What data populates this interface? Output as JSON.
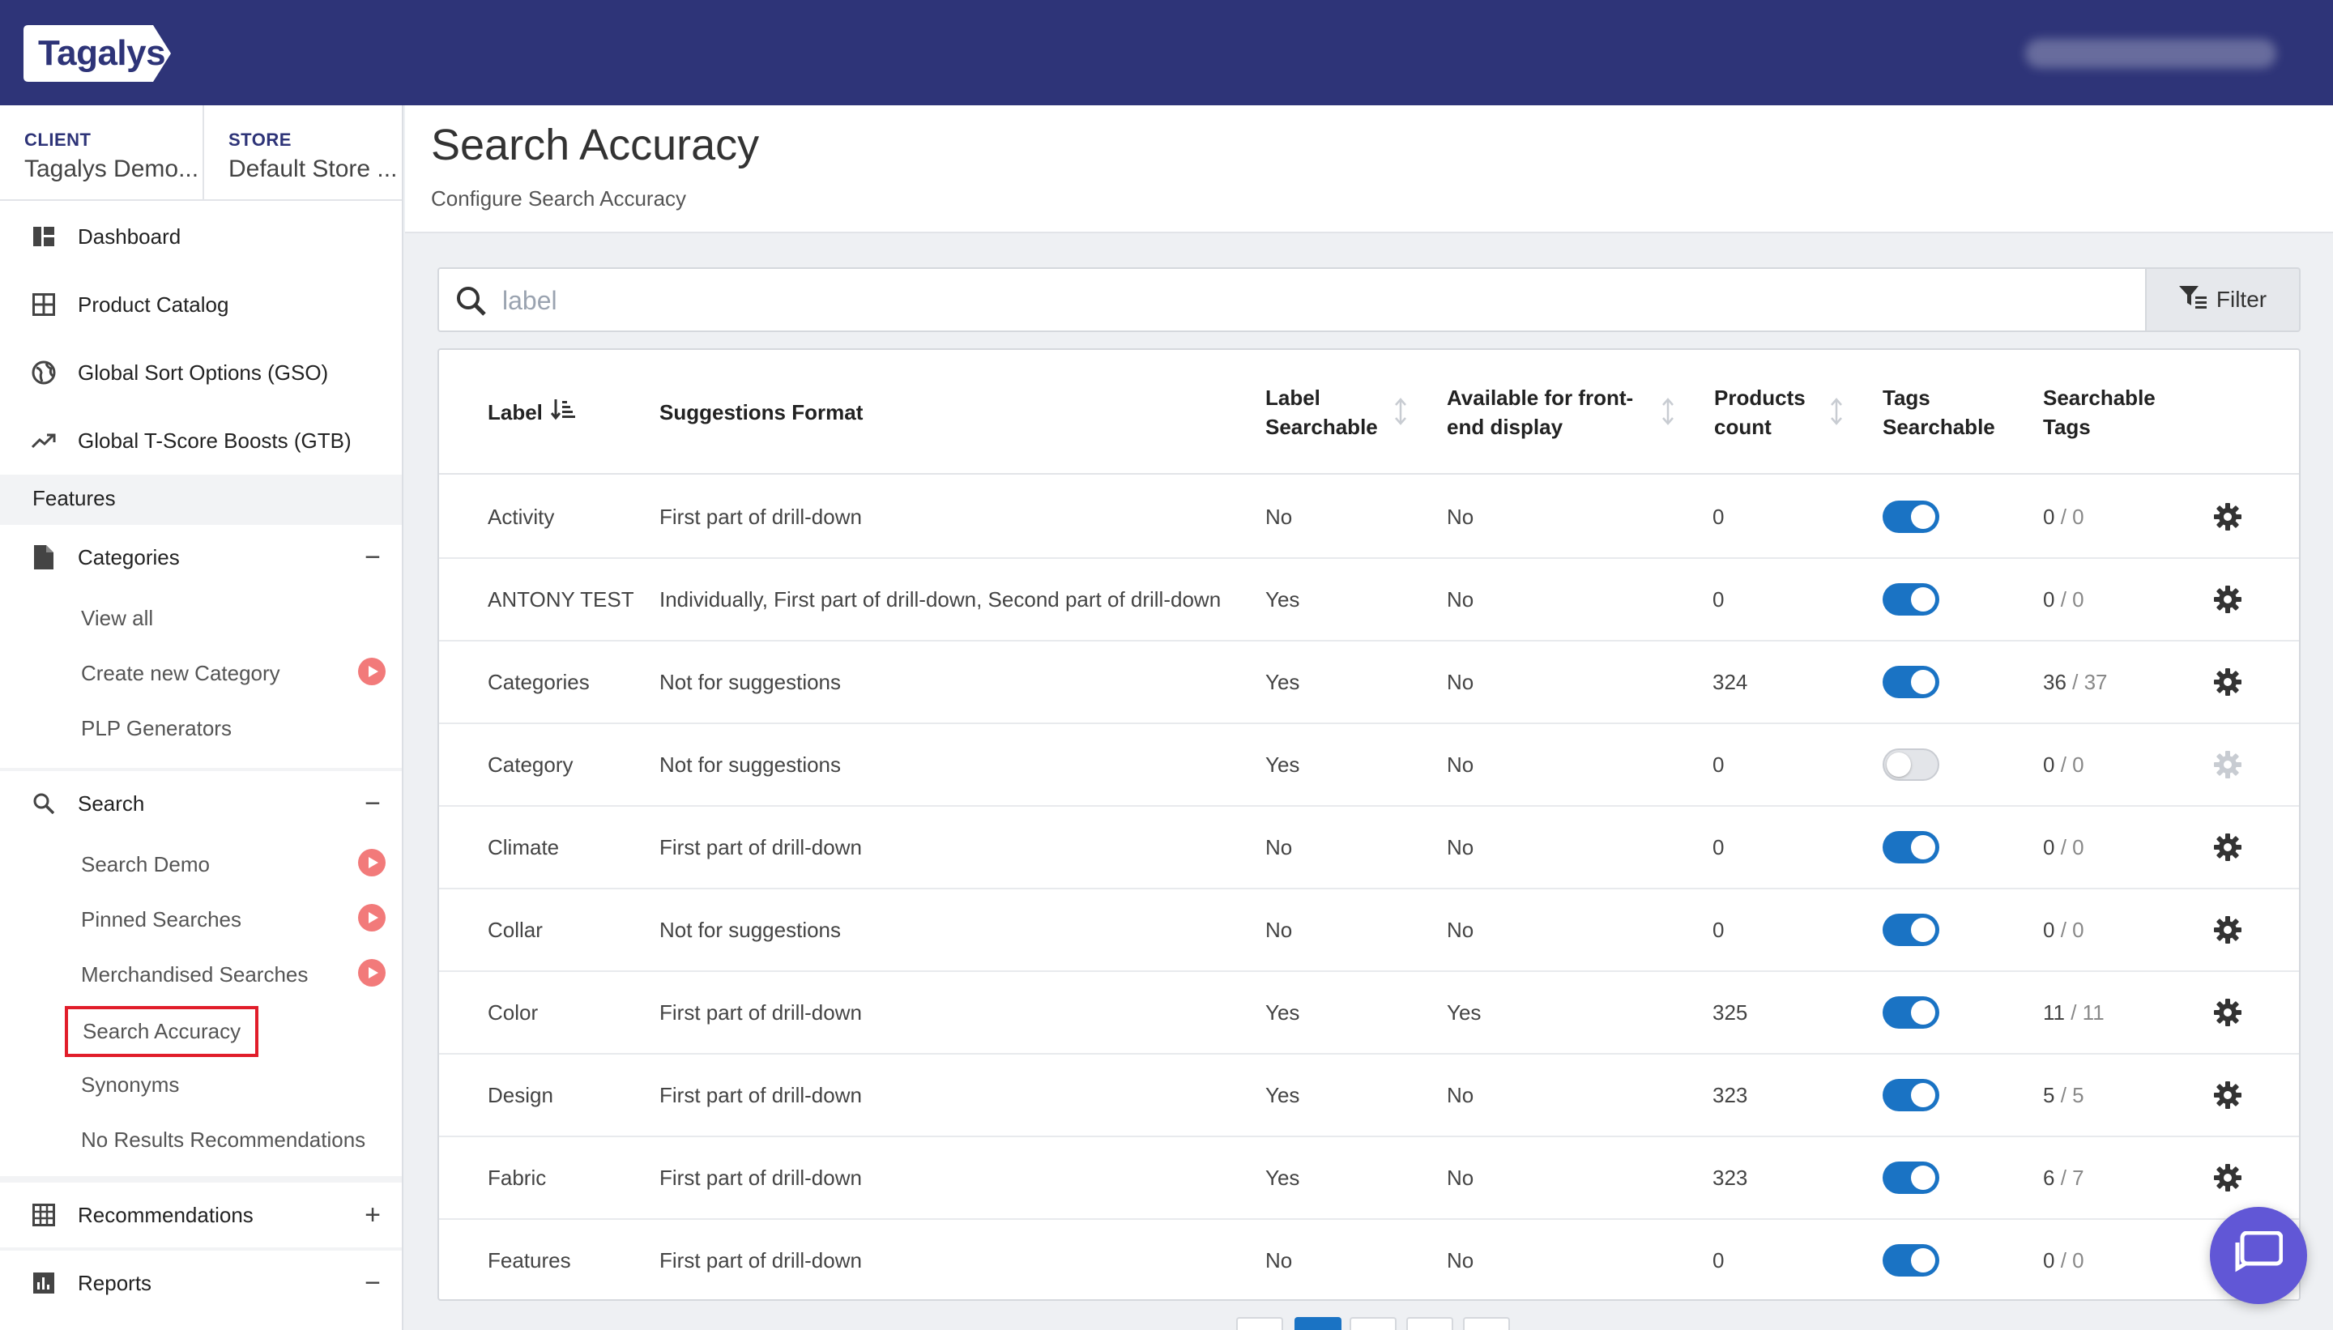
{
  "app": {
    "logo_text": "Tagalys"
  },
  "context": {
    "client_label": "CLIENT",
    "client_value": "Tagalys Demo...",
    "store_label": "STORE",
    "store_value": "Default Store ..."
  },
  "nav": {
    "dashboard": "Dashboard",
    "product_catalog": "Product Catalog",
    "gso": "Global Sort Options (GSO)",
    "gtb": "Global T-Score Boosts (GTB)",
    "features": "Features",
    "categories": "Categories",
    "categories_toggle": "−",
    "view_all": "View all",
    "create_category": "Create new Category",
    "plp_generators": "PLP Generators",
    "search": "Search",
    "search_toggle": "−",
    "search_demo": "Search Demo",
    "pinned_searches": "Pinned Searches",
    "merchandised_searches": "Merchandised Searches",
    "search_accuracy": "Search Accuracy",
    "synonyms": "Synonyms",
    "no_results": "No Results Recommendations",
    "recommendations": "Recommendations",
    "recommendations_toggle": "+",
    "reports": "Reports",
    "reports_toggle": "−"
  },
  "page": {
    "title": "Search Accuracy",
    "subtitle": "Configure Search Accuracy"
  },
  "search": {
    "placeholder": "label",
    "value": ""
  },
  "filter_label": "Filter",
  "columns": {
    "label": "Label",
    "suggestions": "Suggestions Format",
    "label_searchable_1": "Label",
    "label_searchable_2": "Searchable",
    "frontend_1": "Available for front-",
    "frontend_2": "end display",
    "products_1": "Products",
    "products_2": "count",
    "tags_searchable_1": "Tags",
    "tags_searchable_2": "Searchable",
    "searchable_tags_1": "Searchable",
    "searchable_tags_2": "Tags"
  },
  "rows": [
    {
      "label": "Activity",
      "format": "First part of drill-down",
      "label_searchable": "No",
      "frontend": "No",
      "count": "0",
      "tags_on": true,
      "tags_a": "0",
      "tags_b": "0"
    },
    {
      "label": "ANTONY TEST",
      "format": "Individually, First part of drill-down, Second part of drill-down",
      "label_searchable": "Yes",
      "frontend": "No",
      "count": "0",
      "tags_on": true,
      "tags_a": "0",
      "tags_b": "0"
    },
    {
      "label": "Categories",
      "format": "Not for suggestions",
      "label_searchable": "Yes",
      "frontend": "No",
      "count": "324",
      "tags_on": true,
      "tags_a": "36",
      "tags_b": "37"
    },
    {
      "label": "Category",
      "format": "Not for suggestions",
      "label_searchable": "Yes",
      "frontend": "No",
      "count": "0",
      "tags_on": false,
      "tags_a": "0",
      "tags_b": "0"
    },
    {
      "label": "Climate",
      "format": "First part of drill-down",
      "label_searchable": "No",
      "frontend": "No",
      "count": "0",
      "tags_on": true,
      "tags_a": "0",
      "tags_b": "0"
    },
    {
      "label": "Collar",
      "format": "Not for suggestions",
      "label_searchable": "No",
      "frontend": "No",
      "count": "0",
      "tags_on": true,
      "tags_a": "0",
      "tags_b": "0"
    },
    {
      "label": "Color",
      "format": "First part of drill-down",
      "label_searchable": "Yes",
      "frontend": "Yes",
      "count": "325",
      "tags_on": true,
      "tags_a": "11",
      "tags_b": "11"
    },
    {
      "label": "Design",
      "format": "First part of drill-down",
      "label_searchable": "Yes",
      "frontend": "No",
      "count": "323",
      "tags_on": true,
      "tags_a": "5",
      "tags_b": "5"
    },
    {
      "label": "Fabric",
      "format": "First part of drill-down",
      "label_searchable": "Yes",
      "frontend": "No",
      "count": "323",
      "tags_on": true,
      "tags_a": "6",
      "tags_b": "7"
    },
    {
      "label": "Features",
      "format": "First part of drill-down",
      "label_searchable": "No",
      "frontend": "No",
      "count": "0",
      "tags_on": true,
      "tags_a": "0",
      "tags_b": "0"
    }
  ],
  "colors": {
    "brand": "#2e3478",
    "accent": "#1a73c4",
    "highlight": "#e11d2a",
    "badge": "#f27a7a",
    "chat": "#6157d6"
  }
}
